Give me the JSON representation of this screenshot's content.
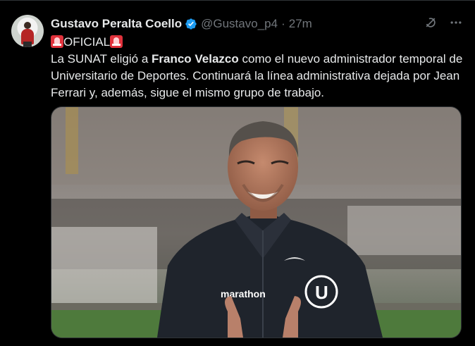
{
  "author": {
    "name": "Gustavo Peralta Coello",
    "handle": "@Gustavo_p4",
    "separator": "·",
    "time": "27m"
  },
  "post": {
    "tag": "OFICIAL",
    "line1_prefix": "La SUNAT eligió a ",
    "line1_bold": "Franco Velazco",
    "line1_suffix": " como el nuevo administrador temporal de Universitario de Deportes. Continuará la línea administrativa dejada por Jean Ferrari y, además, sigue el mismo grupo de trabajo."
  },
  "media": {
    "jacket_brand": "marathon",
    "crest_letter": "U"
  },
  "icons": {
    "verified": "verified-badge-icon",
    "grok": "grok-icon",
    "more": "more-icon",
    "siren": "siren-emoji-icon"
  },
  "colors": {
    "background": "#000000",
    "text": "#e7e9ea",
    "secondary": "#71767b",
    "verified": "#1d9bf0"
  }
}
